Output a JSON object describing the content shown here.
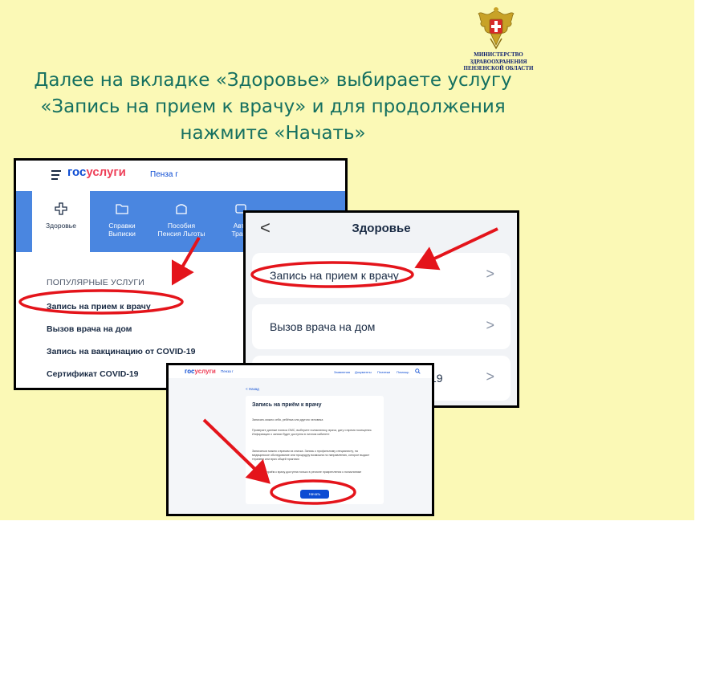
{
  "ministry": {
    "lines": [
      "МИНИСТЕРСТВО",
      "ЗДРАВООХРАНЕНИЯ",
      "ПЕНЗЕНСКОЙ ОБЛАСТИ"
    ]
  },
  "headline": {
    "line1": "Далее на вкладке «Здоровье» выбираете услугу",
    "line2": "«Запись на прием к врачу» и для продолжения",
    "line3": "нажмите «Начать»"
  },
  "colors": {
    "slide_bg": "#fbf9b6",
    "headline": "#157060",
    "arrow": "#e4141b",
    "gos_blue": "#0d4cd3",
    "gos_red": "#ee3f58"
  },
  "screen1": {
    "logo_gos": "гос",
    "logo_uslugi": "услуги",
    "city": "Пенза г",
    "tabs": [
      {
        "line1": "Здоровье",
        "line2": "",
        "icon": "plus-icon"
      },
      {
        "line1": "Справки",
        "line2": "Выписки",
        "icon": "folder-icon"
      },
      {
        "line1": "Пособия",
        "line2": "Пенсия Льготы",
        "icon": "wallet-icon"
      },
      {
        "line1": "Авто",
        "line2": "Транс",
        "icon": "car-icon"
      }
    ],
    "section_title": "ПОПУЛЯРНЫЕ УСЛУГИ",
    "items": [
      "Запись на прием к врачу",
      "Вызов врача на дом",
      "Запись на вакцинацию от COVID-19",
      "Сертификат COVID-19"
    ]
  },
  "screen2": {
    "back": "<",
    "title": "Здоровье",
    "items": [
      "Запись на прием к врачу",
      "Вызов врача на дом",
      "19"
    ],
    "chevron": ">"
  },
  "screen3": {
    "logo_gos": "гос",
    "logo_uslugi": "услуги",
    "city": "Пенза г",
    "nav": [
      "Заявления",
      "Документы",
      "Платежи",
      "Помощь"
    ],
    "back": "< Назад",
    "title": "Запись на приём к врачу",
    "paragraphs": [
      "Записать можно себя, ребёнка или другого человека",
      "Проверьте данные полиса ОМС, выберите поликлинику, врача, дату и время посещения. Информация о записи будет доступна в личном кабинете",
      "Записаться можно к врачам из списка. Запись к профильному специалисту, на медицинское обследование или процедуру возможна по направлению, которое выдаст терапевт или врач общей практики",
      "Запись на приём к врачу доступна только в регионе прикрепления к поликлинике"
    ],
    "button": "Начать"
  }
}
